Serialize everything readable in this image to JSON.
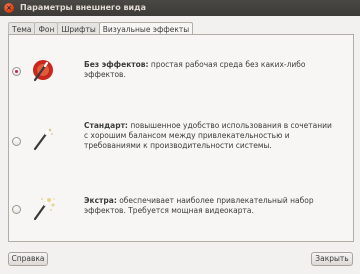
{
  "window": {
    "title": "Параметры внешнего вида",
    "close_glyph": "×"
  },
  "tabs": [
    {
      "label": "Тема"
    },
    {
      "label": "Фон"
    },
    {
      "label": "Шрифты"
    },
    {
      "label": "Визуальные эффекты",
      "active": true
    }
  ],
  "options": [
    {
      "name": "Без эффектов:",
      "description": "простая рабочая среда без каких-либо эффектов.",
      "selected": true,
      "icon": "no-effects-icon"
    },
    {
      "name": "Стандарт:",
      "description": "повышенное удобство использования в сочетании с хорошим балансом между привлекательностью и требованиями к производительности системы.",
      "selected": false,
      "icon": "standard-effects-icon"
    },
    {
      "name": "Экстра:",
      "description": "обеспечивает наиболее привлекательный набор эффектов. Требуется мощная видеокарта.",
      "selected": false,
      "icon": "extra-effects-icon"
    }
  ],
  "buttons": {
    "help": "Справка",
    "close": "Закрыть"
  },
  "colors": {
    "accent": "#c4245a",
    "titlebar": "#3c3b37"
  }
}
